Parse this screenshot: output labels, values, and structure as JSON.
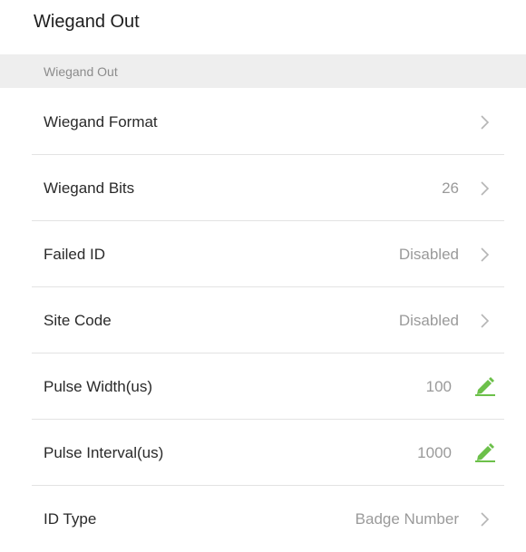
{
  "header": {
    "title": "Wiegand Out"
  },
  "section": {
    "label": "Wiegand Out"
  },
  "rows": [
    {
      "label": "Wiegand Format",
      "value": "",
      "control": "chevron-right-icon"
    },
    {
      "label": "Wiegand Bits",
      "value": "26",
      "control": "chevron-right-icon"
    },
    {
      "label": "Failed ID",
      "value": "Disabled",
      "control": "chevron-right-icon"
    },
    {
      "label": "Site Code",
      "value": "Disabled",
      "control": "chevron-right-icon"
    },
    {
      "label": "Pulse Width(us)",
      "value": "100",
      "control": "pencil-edit-icon"
    },
    {
      "label": "Pulse Interval(us)",
      "value": "1000",
      "control": "pencil-edit-icon"
    },
    {
      "label": "ID Type",
      "value": "Badge Number",
      "control": "chevron-right-icon"
    }
  ],
  "colors": {
    "accent_green": "#6cc04a",
    "chevron": "#b5b5b5",
    "section_bg": "#eeeeee"
  }
}
